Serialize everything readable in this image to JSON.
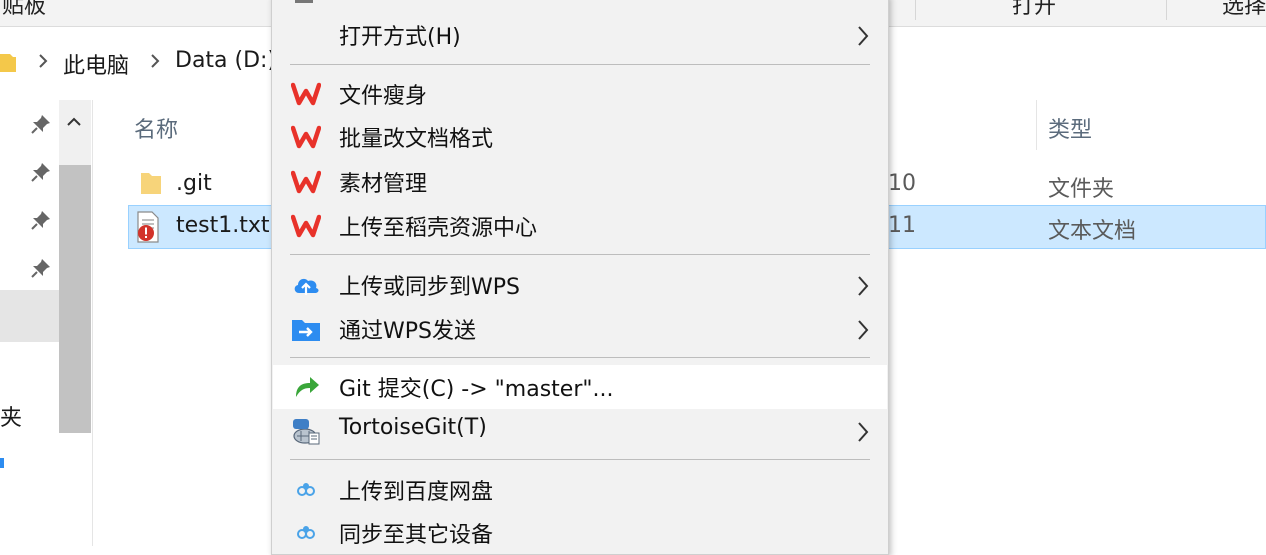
{
  "ribbon": {
    "clipboard_label": "剪贴板",
    "open_label": "打开",
    "select_label": "选择"
  },
  "address": {
    "crumbs": [
      "此电脑",
      "Data (D:)"
    ]
  },
  "nav": {
    "partial_label": "夹"
  },
  "file_list": {
    "col_name": "名称",
    "col_type": "类型",
    "rows": [
      {
        "name": ".git",
        "date_fragment": "10",
        "type": "文件夹"
      },
      {
        "name": "test1.txt",
        "date_fragment": "11",
        "type": "文本文档"
      }
    ]
  },
  "context_menu": {
    "open_with": "打开方式(H)",
    "wps_items": [
      "文件瘦身",
      "批量改文档格式",
      "素材管理",
      "上传至稻壳资源中心"
    ],
    "upload_sync_wps": "上传或同步到WPS",
    "send_via_wps": "通过WPS发送",
    "git_commit": "Git 提交(C) -> \"master\"...",
    "tortoisegit": "TortoiseGit(T)",
    "baidu_upload": "上传到百度网盘",
    "sync_devices": "同步至其它设备"
  },
  "colors": {
    "wps_red": "#e8322a",
    "selection_bg": "#cce8ff",
    "selection_border": "#99d1ff",
    "cloud_blue": "#2d8cf0",
    "git_green": "#3aa63a"
  }
}
